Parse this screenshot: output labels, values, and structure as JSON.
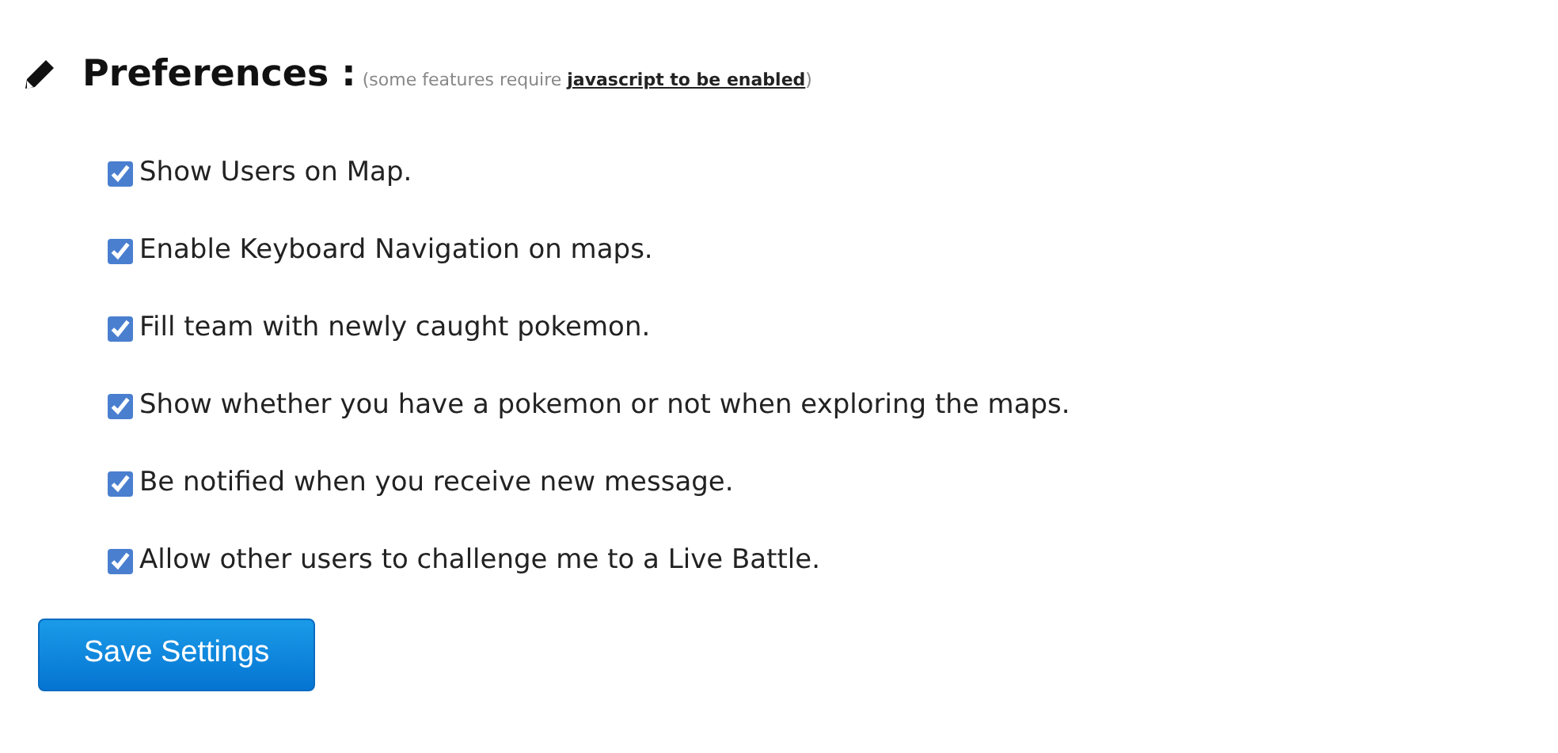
{
  "heading": {
    "title": "Preferences :",
    "note_before": "(some features require ",
    "note_link": "javascript to be enabled",
    "note_after": ")"
  },
  "options": [
    {
      "label": "Show Users on Map.",
      "checked": true
    },
    {
      "label": "Enable Keyboard Navigation on maps.",
      "checked": true
    },
    {
      "label": "Fill team with newly caught pokemon.",
      "checked": true
    },
    {
      "label": "Show whether you have a pokemon or not when exploring the maps.",
      "checked": true
    },
    {
      "label": "Be notified when you receive new message.",
      "checked": true
    },
    {
      "label": "Allow other users to challenge me to a Live Battle.",
      "checked": true
    }
  ],
  "button": "Save Settings"
}
